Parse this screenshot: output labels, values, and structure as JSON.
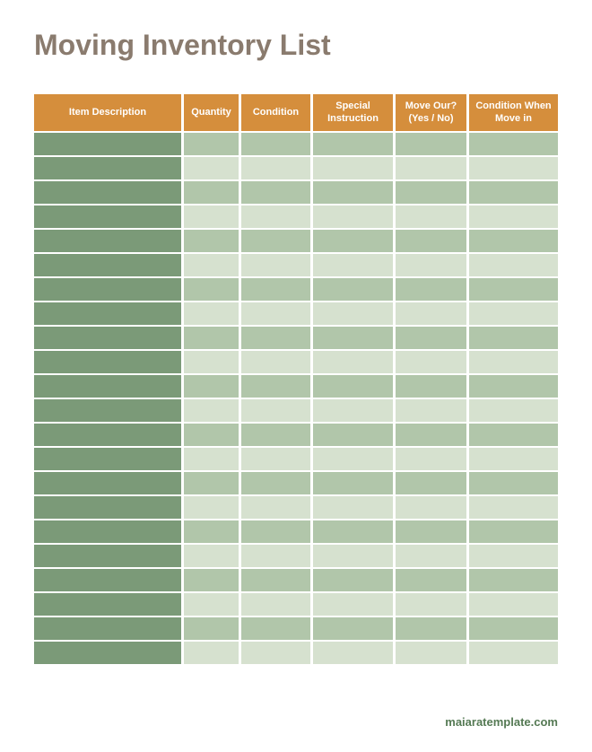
{
  "title": "Moving Inventory List",
  "headers": {
    "col1": "Item Description",
    "col2": "Quantity",
    "col3": "Condition",
    "col4": "Special Instruction",
    "col5": "Move Our? (Yes / No)",
    "col6": "Condition When Move in"
  },
  "row_count": 22,
  "footer": "maiaratemplate.com"
}
